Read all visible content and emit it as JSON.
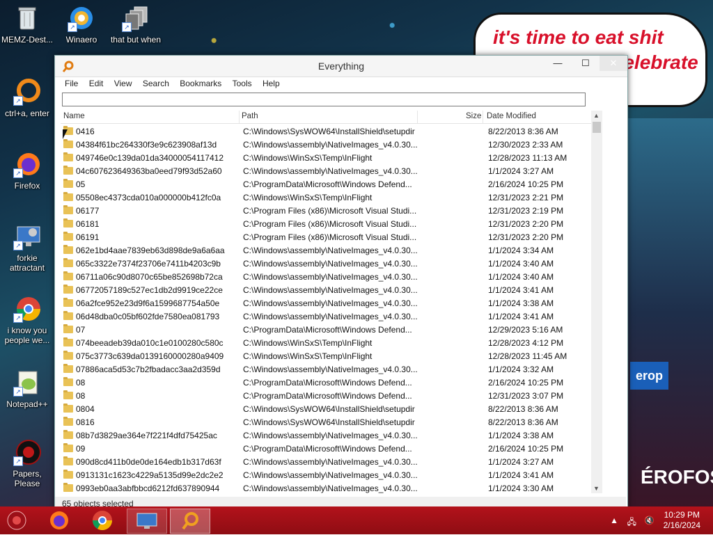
{
  "desktop": {
    "wallpaper_text": "it's time to eat shit",
    "wallpaper_text2": "/celebrate",
    "icons": [
      {
        "label": "MEMZ-Dest...",
        "icon": "recycle-bin-icon"
      },
      {
        "label": "Winaero",
        "icon": "winaero-icon"
      },
      {
        "label": "that but when",
        "icon": "stack-windows-icon"
      },
      {
        "label": "ctrl+a, enter",
        "icon": "ring-icon"
      },
      {
        "label": "Firefox",
        "icon": "firefox-icon"
      },
      {
        "label": "forkie attractant",
        "icon": "monitor-gear-icon"
      },
      {
        "label": "i know you people we...",
        "icon": "chrome-icon"
      },
      {
        "label": "Notepad++",
        "icon": "notepadpp-icon"
      },
      {
        "label": "Papers, Please",
        "icon": "papers-please-icon"
      }
    ]
  },
  "window": {
    "title": "Everything",
    "menu": [
      "File",
      "Edit",
      "View",
      "Search",
      "Bookmarks",
      "Tools",
      "Help"
    ],
    "search": {
      "value": "",
      "placeholder": ""
    },
    "columns": {
      "name": "Name",
      "path": "Path",
      "size": "Size",
      "date": "Date Modified"
    },
    "rows": [
      {
        "name": "0416",
        "path": "C:\\Windows\\SysWOW64\\InstallShield\\setupdir",
        "date": "8/22/2013 8:36 AM"
      },
      {
        "name": "04384f61bc264330f3e9c623908af13d",
        "path": "C:\\Windows\\assembly\\NativeImages_v4.0.30...",
        "date": "12/30/2023 2:33 AM"
      },
      {
        "name": "049746e0c139da01da34000054117412",
        "path": "C:\\Windows\\WinSxS\\Temp\\InFlight",
        "date": "12/28/2023 11:13 AM"
      },
      {
        "name": "04c607623649363ba0eed79f93d52a60",
        "path": "C:\\Windows\\assembly\\NativeImages_v4.0.30...",
        "date": "1/1/2024 3:27 AM"
      },
      {
        "name": "05",
        "path": "C:\\ProgramData\\Microsoft\\Windows Defend...",
        "date": "2/16/2024 10:25 PM"
      },
      {
        "name": "05508ec4373cda010a000000b412fc0a",
        "path": "C:\\Windows\\WinSxS\\Temp\\InFlight",
        "date": "12/31/2023 2:21 PM"
      },
      {
        "name": "06177",
        "path": "C:\\Program Files (x86)\\Microsoft Visual Studi...",
        "date": "12/31/2023 2:19 PM"
      },
      {
        "name": "06181",
        "path": "C:\\Program Files (x86)\\Microsoft Visual Studi...",
        "date": "12/31/2023 2:20 PM"
      },
      {
        "name": "06191",
        "path": "C:\\Program Files (x86)\\Microsoft Visual Studi...",
        "date": "12/31/2023 2:20 PM"
      },
      {
        "name": "062e1bd4aae7839eb63d898de9a6a6aa",
        "path": "C:\\Windows\\assembly\\NativeImages_v4.0.30...",
        "date": "1/1/2024 3:34 AM"
      },
      {
        "name": "065c3322e7374f23706e7411b4203c9b",
        "path": "C:\\Windows\\assembly\\NativeImages_v4.0.30...",
        "date": "1/1/2024 3:40 AM"
      },
      {
        "name": "06711a06c90d8070c65be852698b72ca",
        "path": "C:\\Windows\\assembly\\NativeImages_v4.0.30...",
        "date": "1/1/2024 3:40 AM"
      },
      {
        "name": "06772057189c527ec1db2d9919ce22ce",
        "path": "C:\\Windows\\assembly\\NativeImages_v4.0.30...",
        "date": "1/1/2024 3:41 AM"
      },
      {
        "name": "06a2fce952e23d9f6a1599687754a50e",
        "path": "C:\\Windows\\assembly\\NativeImages_v4.0.30...",
        "date": "1/1/2024 3:38 AM"
      },
      {
        "name": "06d48dba0c05bf602fde7580ea081793",
        "path": "C:\\Windows\\assembly\\NativeImages_v4.0.30...",
        "date": "1/1/2024 3:41 AM"
      },
      {
        "name": "07",
        "path": "C:\\ProgramData\\Microsoft\\Windows Defend...",
        "date": "12/29/2023 5:16 AM"
      },
      {
        "name": "074beeadeb39da010c1e0100280c580c",
        "path": "C:\\Windows\\WinSxS\\Temp\\InFlight",
        "date": "12/28/2023 4:12 PM"
      },
      {
        "name": "075c3773c639da0139160000280a9409",
        "path": "C:\\Windows\\WinSxS\\Temp\\InFlight",
        "date": "12/28/2023 11:45 AM"
      },
      {
        "name": "07886aca5d53c7b2fbadacc3aa2d359d",
        "path": "C:\\Windows\\assembly\\NativeImages_v4.0.30...",
        "date": "1/1/2024 3:32 AM"
      },
      {
        "name": "08",
        "path": "C:\\ProgramData\\Microsoft\\Windows Defend...",
        "date": "2/16/2024 10:25 PM"
      },
      {
        "name": "08",
        "path": "C:\\ProgramData\\Microsoft\\Windows Defend...",
        "date": "12/31/2023 3:07 PM"
      },
      {
        "name": "0804",
        "path": "C:\\Windows\\SysWOW64\\InstallShield\\setupdir",
        "date": "8/22/2013 8:36 AM"
      },
      {
        "name": "0816",
        "path": "C:\\Windows\\SysWOW64\\InstallShield\\setupdir",
        "date": "8/22/2013 8:36 AM"
      },
      {
        "name": "08b7d3829ae364e7f221f4dfd75425ac",
        "path": "C:\\Windows\\assembly\\NativeImages_v4.0.30...",
        "date": "1/1/2024 3:38 AM"
      },
      {
        "name": "09",
        "path": "C:\\ProgramData\\Microsoft\\Windows Defend...",
        "date": "2/16/2024 10:25 PM"
      },
      {
        "name": "090d8cd411b0de0de164edb1b317d63f",
        "path": "C:\\Windows\\assembly\\NativeImages_v4.0.30...",
        "date": "1/1/2024 3:27 AM"
      },
      {
        "name": "0913131c1623c4229a5135d99e2dc2e2",
        "path": "C:\\Windows\\assembly\\NativeImages_v4.0.30...",
        "date": "1/1/2024 3:41 AM"
      },
      {
        "name": "0993eb0aa3abfbbcd6212fd637890944",
        "path": "C:\\Windows\\assembly\\NativeImages_v4.0.30...",
        "date": "1/1/2024 3:30 AM"
      }
    ],
    "status": "65 objects selected"
  },
  "taskbar": {
    "items": [
      "start-orb-icon",
      "firefox-icon",
      "chrome-icon",
      "forkie-icon",
      "everything-icon"
    ],
    "clock_time": "10:29 PM",
    "clock_date": "2/16/2024"
  },
  "colors": {
    "taskbar": "#b3121b",
    "folder": "#e9c256",
    "bubble_text": "#d8102a"
  }
}
